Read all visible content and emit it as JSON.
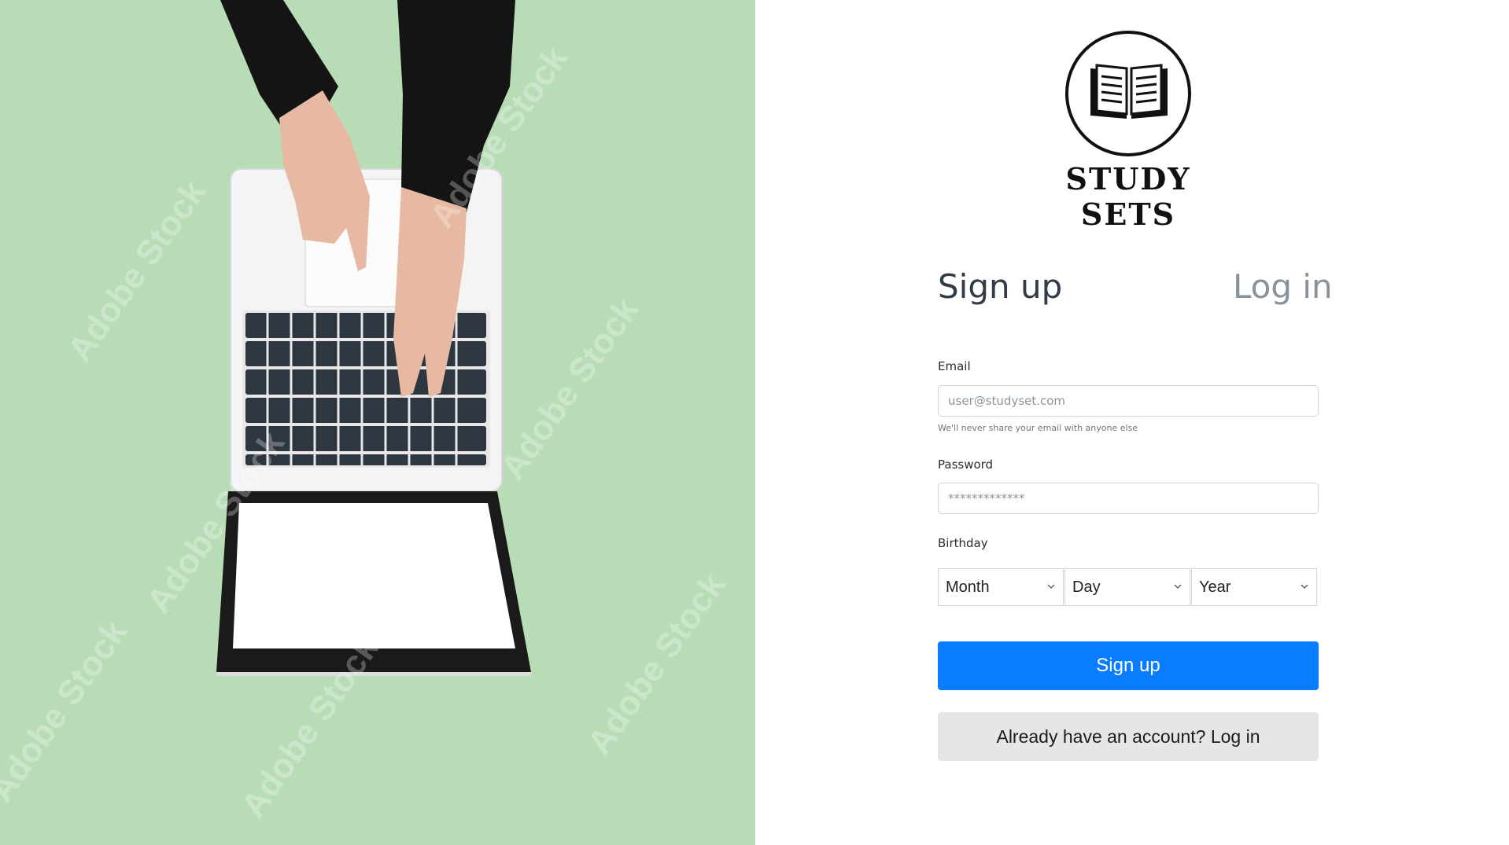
{
  "hero": {
    "watermark_text": "Adobe Stock",
    "background_color": "#b8ddb6"
  },
  "brand": {
    "name": "STUDY SETS",
    "icon": "open-book-icon"
  },
  "tabs": {
    "signup_label": "Sign up",
    "login_label": "Log in",
    "active": "signup"
  },
  "form": {
    "email_label": "Email",
    "email_placeholder": "user@studyset.com",
    "email_hint": "We'll never share your email with anyone else",
    "password_label": "Password",
    "password_placeholder": "*************",
    "birthday_label": "Birthday",
    "month_value": "Month",
    "day_value": "Day",
    "year_value": "Year"
  },
  "actions": {
    "signup_button": "Sign up",
    "login_link_button": "Already have an account? Log in"
  },
  "colors": {
    "primary": "#0a7cff",
    "secondary_bg": "#e6e6e6"
  }
}
